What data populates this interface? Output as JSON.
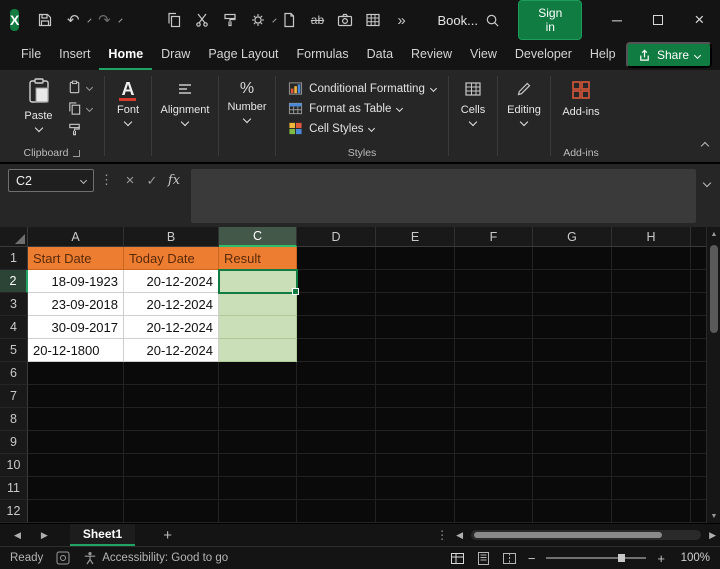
{
  "titlebar": {
    "title": "Book...",
    "sign_in": "Sign in"
  },
  "menu": {
    "items": [
      "File",
      "Insert",
      "Home",
      "Draw",
      "Page Layout",
      "Formulas",
      "Data",
      "Review",
      "View",
      "Developer",
      "Help"
    ],
    "active_item": "Home",
    "share": "Share"
  },
  "ribbon": {
    "paste": "Paste",
    "font": "Font",
    "alignment": "Alignment",
    "number": "Number",
    "conditional_formatting": "Conditional Formatting",
    "format_as_table": "Format as Table",
    "cell_styles": "Cell Styles",
    "cells": "Cells",
    "editing": "Editing",
    "addins": "Add-ins",
    "groups": {
      "clipboard": "Clipboard",
      "styles": "Styles",
      "addins": "Add-ins"
    }
  },
  "formula_bar": {
    "name_box": "C2",
    "fx": "fx",
    "value": ""
  },
  "grid": {
    "columns": [
      "A",
      "B",
      "C",
      "D",
      "E",
      "F",
      "G",
      "H"
    ],
    "rows": [
      "1",
      "2",
      "3",
      "4",
      "5",
      "6",
      "7",
      "8",
      "9",
      "10",
      "11",
      "12"
    ],
    "selected_cell": "C2",
    "header_row": [
      "Start Date",
      "Today Date",
      "Result"
    ],
    "data": [
      [
        "18-09-1923",
        "20-12-2024",
        ""
      ],
      [
        "23-09-2018",
        "20-12-2024",
        ""
      ],
      [
        "30-09-2017",
        "20-12-2024",
        ""
      ],
      [
        "20-12-1800",
        "20-12-2024",
        ""
      ]
    ]
  },
  "sheet_bar": {
    "active_tab": "Sheet1",
    "add_label": "+"
  },
  "status_bar": {
    "mode": "Ready",
    "accessibility": "Accessibility: Good to go",
    "zoom_level": "100%"
  },
  "colors": {
    "accent_green": "#107C41",
    "tab_underline": "#21A366",
    "header_fill": "#ED7D31",
    "result_fill": "#CADFB8",
    "selection_border": "#107C41"
  },
  "icons": {
    "logo": "X",
    "undo": "↶",
    "redo": "↷",
    "overflow": "»",
    "more": "⋮",
    "minimize": "─",
    "close": "×",
    "cancel": "×",
    "check": "✓",
    "strike_sample": "ab",
    "font_sample": "A",
    "percent": "%",
    "prev": "◀",
    "next": "▶",
    "up": "▲",
    "down": "▼",
    "plus": "+",
    "minus": "−"
  }
}
